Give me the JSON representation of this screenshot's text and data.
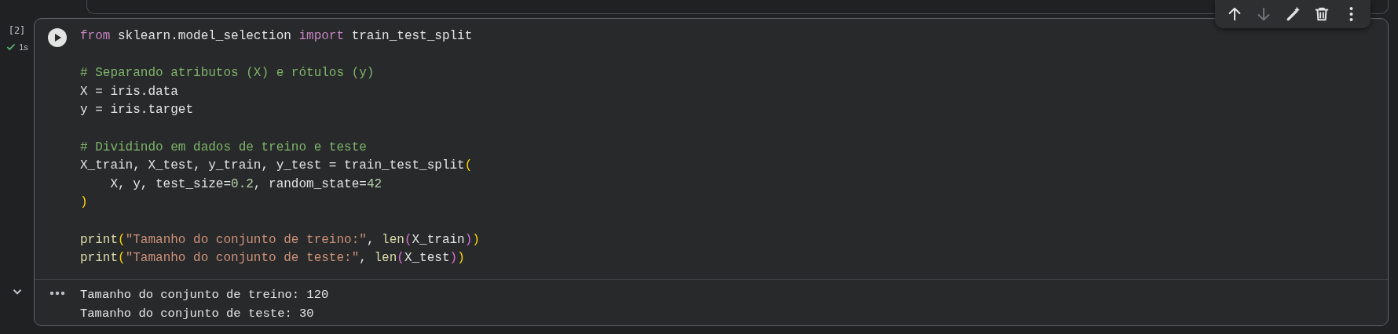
{
  "cell": {
    "execution_count": "[2]",
    "run_time": "1s",
    "succeeded": true,
    "code_blocks": [
      [
        [
          {
            "kind": "keyword",
            "text": "from"
          },
          {
            "kind": "plain",
            "text": " sklearn.model_selection "
          },
          {
            "kind": "keyword",
            "text": "import"
          },
          {
            "kind": "plain",
            "text": " train_test_split"
          }
        ]
      ],
      [
        [
          {
            "kind": "comment",
            "text": "# Separando atributos (X) e rótulos (y)"
          }
        ],
        [
          {
            "kind": "plain",
            "text": "X = iris.data"
          }
        ],
        [
          {
            "kind": "plain",
            "text": "y = iris.target"
          }
        ]
      ],
      [
        [
          {
            "kind": "comment",
            "text": "# Dividindo em dados de treino e teste"
          }
        ],
        [
          {
            "kind": "plain",
            "text": "X_train, X_test, y_train, y_test = train_test_split"
          },
          {
            "kind": "paren1",
            "text": "("
          }
        ],
        [
          {
            "kind": "plain",
            "text": "    X, y, test_size="
          },
          {
            "kind": "number",
            "text": "0.2"
          },
          {
            "kind": "plain",
            "text": ", random_state="
          },
          {
            "kind": "number",
            "text": "42"
          }
        ],
        [
          {
            "kind": "paren1",
            "text": ")"
          }
        ]
      ],
      [
        [
          {
            "kind": "func",
            "text": "print"
          },
          {
            "kind": "paren1",
            "text": "("
          },
          {
            "kind": "string",
            "text": "\"Tamanho do conjunto de treino:\""
          },
          {
            "kind": "plain",
            "text": ", "
          },
          {
            "kind": "func",
            "text": "len"
          },
          {
            "kind": "paren2",
            "text": "("
          },
          {
            "kind": "plain",
            "text": "X_train"
          },
          {
            "kind": "paren2",
            "text": ")"
          },
          {
            "kind": "paren1",
            "text": ")"
          }
        ],
        [
          {
            "kind": "func",
            "text": "print"
          },
          {
            "kind": "paren1",
            "text": "("
          },
          {
            "kind": "string",
            "text": "\"Tamanho do conjunto de teste:\""
          },
          {
            "kind": "plain",
            "text": ", "
          },
          {
            "kind": "func",
            "text": "len"
          },
          {
            "kind": "paren2",
            "text": "("
          },
          {
            "kind": "plain",
            "text": "X_test"
          },
          {
            "kind": "paren2",
            "text": ")"
          },
          {
            "kind": "paren1",
            "text": ")"
          }
        ]
      ]
    ],
    "output": {
      "expanded": true,
      "lines": [
        "Tamanho do conjunto de treino: 120",
        "Tamanho do conjunto de teste: 30"
      ]
    }
  },
  "toolbar": [
    {
      "kind": "move-up",
      "disabled": false
    },
    {
      "kind": "move-down",
      "disabled": true
    },
    {
      "kind": "edit",
      "disabled": false
    },
    {
      "kind": "delete",
      "disabled": false
    },
    {
      "kind": "more",
      "disabled": false
    }
  ]
}
